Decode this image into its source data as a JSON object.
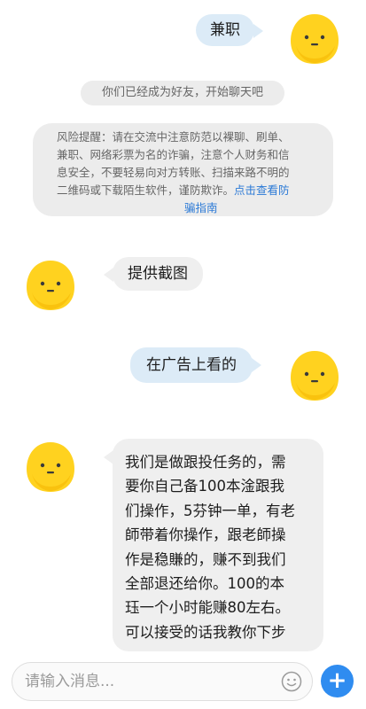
{
  "colors": {
    "outgoing_bubble": "#dcebf7",
    "incoming_bubble": "#efefef",
    "system_background": "#ececec",
    "link": "#2c7ad6",
    "accent_button": "#2f8cf0",
    "avatar": "#ffd21f"
  },
  "icons": {
    "avatar": "yellow-blob-face-icon",
    "emoji": "smiley-face-icon",
    "add": "plus-icon"
  },
  "messages": {
    "m1": "兼职",
    "m2": "提供截图",
    "m3": "在广告上看的",
    "m4_lines": [
      "我们是做跟投任务的，需",
      "要你自己备100本淦跟我",
      "们操作，5芬钟一单，有老",
      "師带着你操作，跟老師操",
      "作是稳賺的，赚不到我们",
      "全部退还给你。100的本",
      "珏一个小时能赚80左右。",
      "可以接受的话我教你下步"
    ]
  },
  "system": {
    "friend_notice": "你们已经成为好友，开始聊天吧",
    "risk_lines": [
      "风险提醒：请在交流中注意防范以裸聊、刷单、",
      "兼职、网络彩票为名的诈骗，注意个人财务和信",
      "息安全，不要轻易向对方转账、扫描来路不明的",
      "二维码或下载陌生软件，谨防欺诈。"
    ],
    "risk_link_part1": "点击查看防",
    "risk_link_part2": "骗指南"
  },
  "input": {
    "placeholder": "请输入消息..."
  }
}
